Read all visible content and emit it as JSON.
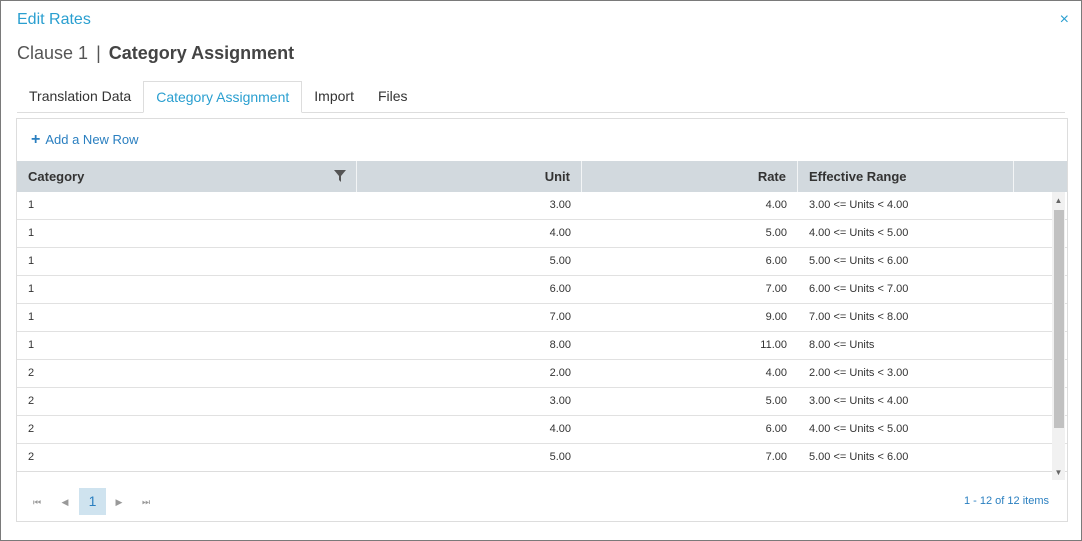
{
  "dialog": {
    "title": "Edit Rates",
    "close_glyph": "×",
    "subtitle_prefix": "Clause 1",
    "subtitle_separator": "|",
    "subtitle_section": "Category Assignment"
  },
  "tabs": [
    {
      "label": "Translation Data",
      "active": false
    },
    {
      "label": "Category Assignment",
      "active": true
    },
    {
      "label": "Import",
      "active": false
    },
    {
      "label": "Files",
      "active": false
    }
  ],
  "toolbar": {
    "add_glyph": "+",
    "add_label": "Add a New Row",
    "add_icon": "plus-icon"
  },
  "grid": {
    "columns": [
      "Category",
      "Unit",
      "Rate",
      "Effective Range"
    ],
    "filter_icon": "filter-icon",
    "rows": [
      {
        "category": "1",
        "unit": "3.00",
        "rate": "4.00",
        "range": "3.00 <= Units < 4.00"
      },
      {
        "category": "1",
        "unit": "4.00",
        "rate": "5.00",
        "range": "4.00 <= Units < 5.00"
      },
      {
        "category": "1",
        "unit": "5.00",
        "rate": "6.00",
        "range": "5.00 <= Units < 6.00"
      },
      {
        "category": "1",
        "unit": "6.00",
        "rate": "7.00",
        "range": "6.00 <= Units < 7.00"
      },
      {
        "category": "1",
        "unit": "7.00",
        "rate": "9.00",
        "range": "7.00 <= Units < 8.00"
      },
      {
        "category": "1",
        "unit": "8.00",
        "rate": "11.00",
        "range": "8.00 <= Units"
      },
      {
        "category": "2",
        "unit": "2.00",
        "rate": "4.00",
        "range": "2.00 <= Units < 3.00"
      },
      {
        "category": "2",
        "unit": "3.00",
        "rate": "5.00",
        "range": "3.00 <= Units < 4.00"
      },
      {
        "category": "2",
        "unit": "4.00",
        "rate": "6.00",
        "range": "4.00 <= Units < 5.00"
      },
      {
        "category": "2",
        "unit": "5.00",
        "rate": "7.00",
        "range": "5.00 <= Units < 6.00"
      }
    ]
  },
  "pager": {
    "first_glyph": "⏮",
    "prev_glyph": "◀",
    "next_glyph": "▶",
    "last_glyph": "⏭",
    "current_page": "1",
    "info": "1 - 12 of 12 items"
  },
  "colors": {
    "accent": "#2a9fd0",
    "link": "#2a7fc0",
    "header_bg": "#d2d9de",
    "active_page_bg": "#cfe3ef"
  }
}
